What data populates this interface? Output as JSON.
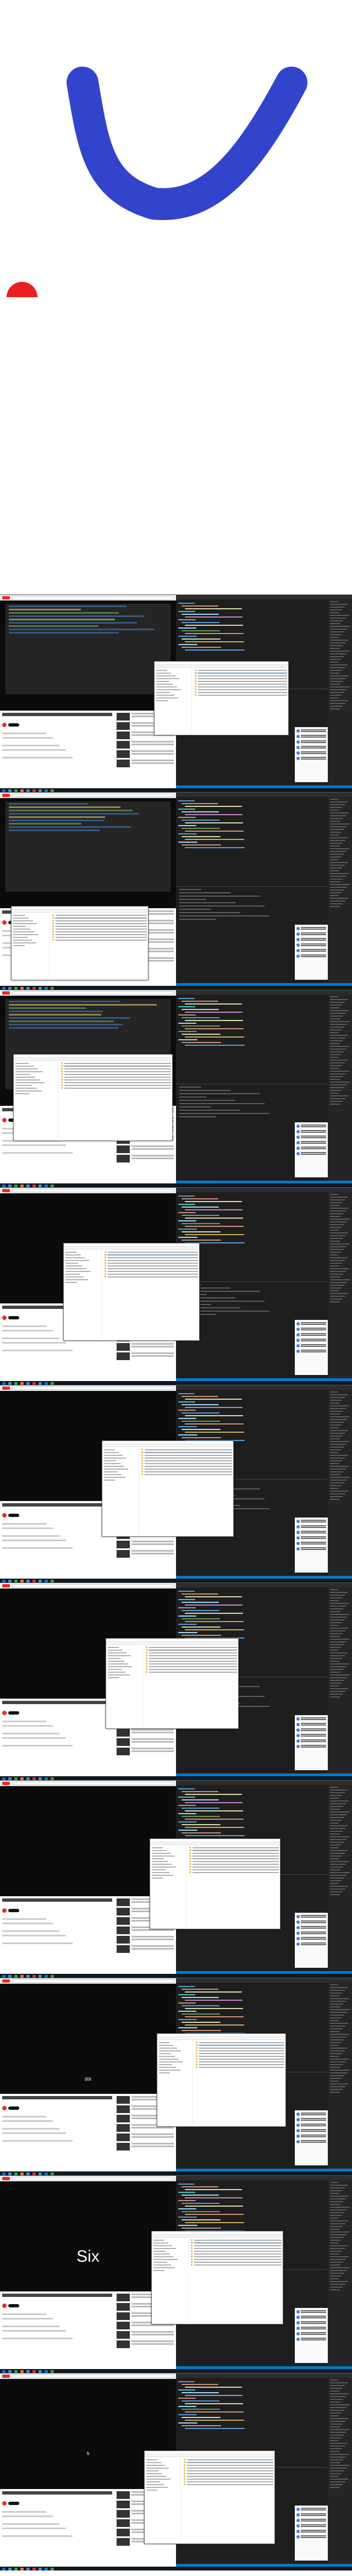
{
  "strokes": [
    {
      "name": "blue-stroke",
      "color": "#3344cc"
    },
    {
      "name": "red-stroke",
      "color": "#e82020"
    }
  ],
  "frames": [
    {
      "player": "editor",
      "caption": ""
    },
    {
      "player": "editor",
      "caption": ""
    },
    {
      "player": "editor",
      "caption": ""
    },
    {
      "player": "black",
      "caption": ""
    },
    {
      "player": "black",
      "caption": ""
    },
    {
      "player": "black",
      "caption": ""
    },
    {
      "player": "black",
      "caption": ""
    },
    {
      "player": "black",
      "caption": "six"
    },
    {
      "player": "black",
      "caption": "Six"
    },
    {
      "player": "black",
      "caption": "s"
    }
  ],
  "colors": {
    "vscode_bg": "#1e1e1e",
    "vscode_status": "#007acc",
    "youtube_red": "#e52d27",
    "taskbar": "#101820",
    "explorer_selection": "#cce8ff"
  }
}
